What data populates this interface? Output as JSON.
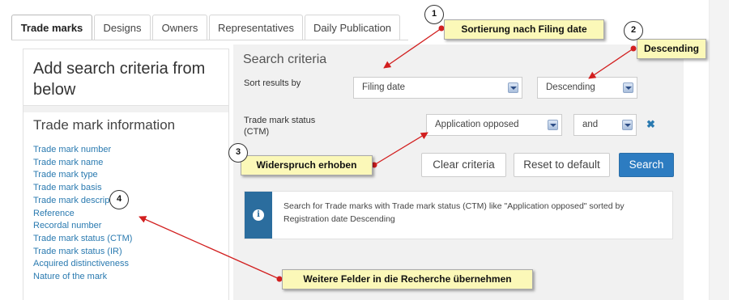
{
  "tabs": [
    {
      "label": "Trade marks",
      "active": true
    },
    {
      "label": "Designs",
      "active": false
    },
    {
      "label": "Owners",
      "active": false
    },
    {
      "label": "Representatives",
      "active": false
    },
    {
      "label": "Daily Publication",
      "active": false
    }
  ],
  "left_panel": {
    "title": "Add search criteria from below",
    "section_title": "Trade mark information",
    "links": [
      "Trade mark number",
      "Trade mark name",
      "Trade mark type",
      "Trade mark basis",
      "Trade mark description",
      "Reference",
      "Recordal number",
      "Trade mark status (CTM)",
      "Trade mark status (IR)",
      "Acquired distinctiveness",
      "Nature of the mark"
    ]
  },
  "criteria": {
    "title": "Search criteria",
    "sort_label": "Sort results by",
    "sort_field": "Filing date",
    "sort_order": "Descending",
    "status_label": "Trade mark status (CTM)",
    "status_value": "Application opposed",
    "operator_value": "and",
    "remove_icon": "✖",
    "clear_label": "Clear criteria",
    "reset_label": "Reset to default",
    "search_label": "Search",
    "info_icon": "i",
    "info_text": "Search for Trade marks with Trade mark status (CTM) like \"Application opposed\" sorted by Registration date Descending"
  },
  "annotations": [
    {
      "number": "1",
      "text": "Sortierung nach Filing date"
    },
    {
      "number": "2",
      "text": "Descending"
    },
    {
      "number": "3",
      "text": "Widerspruch erhoben"
    },
    {
      "number": "4",
      "text": "Weitere Felder in die Recherche übernehmen"
    }
  ],
  "colors": {
    "link": "#2a7ab0",
    "primary_button": "#2d7cc1",
    "info_strip": "#2b6d9e",
    "callout_bg": "#fbf8b8",
    "annotation_arrow": "#d21f1f"
  }
}
